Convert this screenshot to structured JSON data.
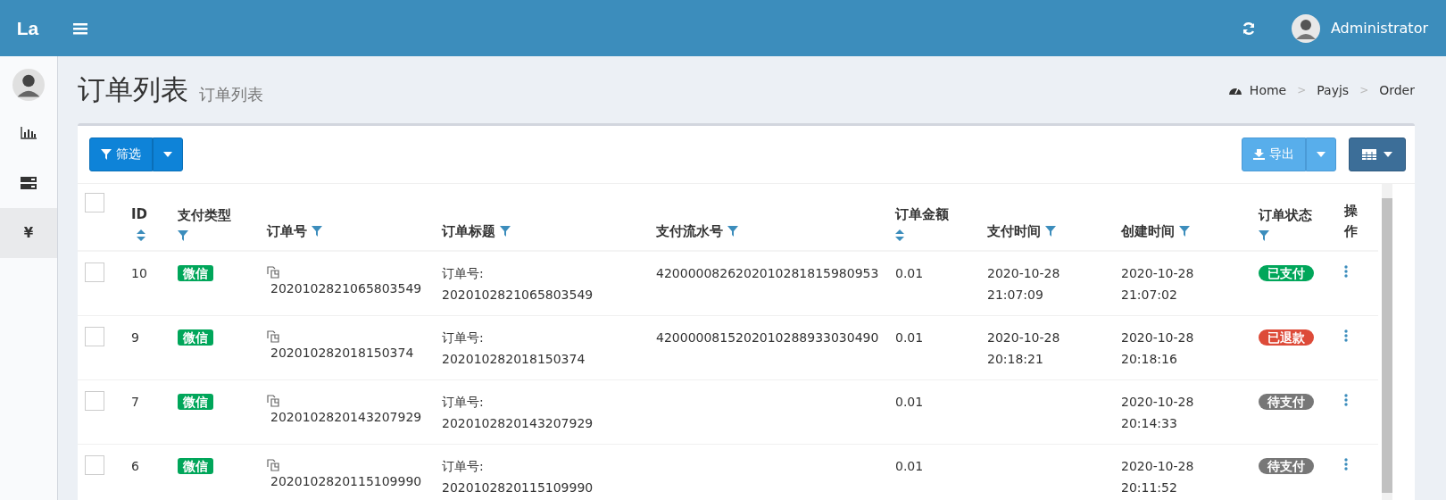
{
  "header": {
    "logo": "La",
    "user": {
      "name": "Administrator"
    }
  },
  "sidebar": {
    "items": [
      {
        "kind": "chart",
        "selected": false
      },
      {
        "kind": "server",
        "selected": false
      },
      {
        "kind": "text",
        "label": "¥",
        "selected": true
      }
    ]
  },
  "page": {
    "title": "订单列表",
    "subtitle": "订单列表",
    "breadcrumb": [
      "Home",
      "Payjs",
      "Order"
    ],
    "separator": ">"
  },
  "toolbar": {
    "filter_button": "筛选",
    "export_button": "导出"
  },
  "table": {
    "select_all_checked": false,
    "columns": [
      {
        "label": "ID",
        "kind": "sort"
      },
      {
        "label": "支付类型",
        "kind": "filter"
      },
      {
        "label": "订单号",
        "kind": "filter"
      },
      {
        "label": "订单标题",
        "kind": "filter"
      },
      {
        "label": "支付流水号",
        "kind": "filter"
      },
      {
        "label": "订单金额",
        "kind": "sort"
      },
      {
        "label": "支付时间",
        "kind": "filter"
      },
      {
        "label": "创建时间",
        "kind": "filter"
      },
      {
        "label": "订单状态",
        "kind": "filter"
      },
      {
        "label": "操作",
        "kind": "none"
      }
    ],
    "rows": [
      {
        "checked": false,
        "id": "10",
        "pay_type": "微信",
        "order_no": "2020102821065803549",
        "title": "订单号: 2020102821065803549",
        "transaction_no": "4200000826202010281815980953",
        "amount": "0.01",
        "paid_at": "2020-10-28 21:07:09",
        "created_at": "2020-10-28 21:07:02",
        "status": {
          "label": "已支付",
          "color": "#00a65a"
        }
      },
      {
        "checked": false,
        "id": "9",
        "pay_type": "微信",
        "order_no": "202010282018150374",
        "title": "订单号: 202010282018150374",
        "transaction_no": "4200000815202010288933030490",
        "amount": "0.01",
        "paid_at": "2020-10-28 20:18:21",
        "created_at": "2020-10-28 20:18:16",
        "status": {
          "label": "已退款",
          "color": "#dd4b39"
        }
      },
      {
        "checked": false,
        "id": "7",
        "pay_type": "微信",
        "order_no": "2020102820143207929",
        "title": "订单号: 2020102820143207929",
        "amount": "0.01",
        "created_at": "2020-10-28 20:14:33",
        "status": {
          "label": "待支付",
          "color": "#777777"
        }
      },
      {
        "checked": false,
        "id": "6",
        "pay_type": "微信",
        "order_no": "2020102820115109990",
        "title": "订单号: 2020102820115109990",
        "amount": "0.01",
        "created_at": "2020-10-28 20:11:52",
        "status": {
          "label": "待支付",
          "color": "#777777"
        }
      }
    ]
  }
}
